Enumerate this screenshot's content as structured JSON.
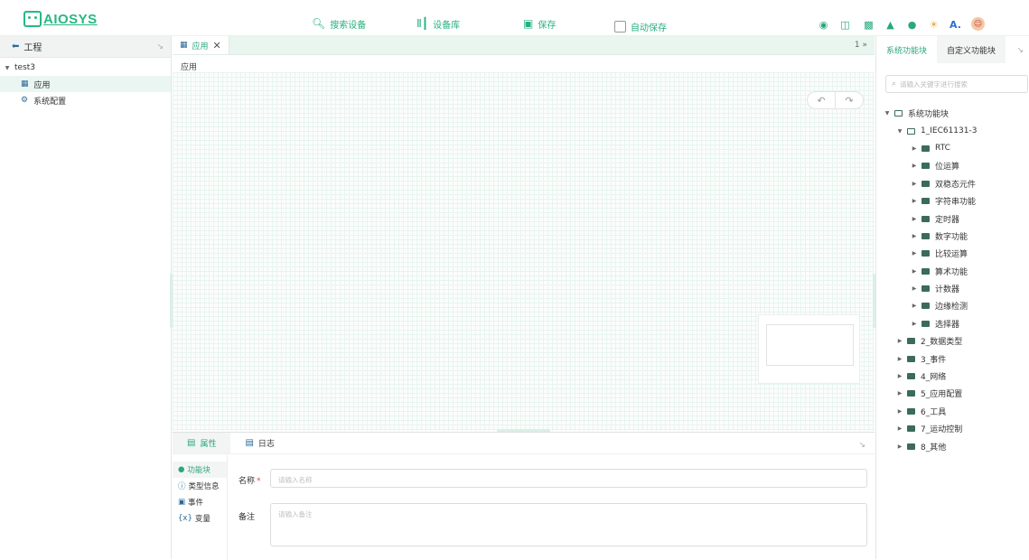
{
  "app": {
    "logo_text": "AIOSYS",
    "accent": "#28b784"
  },
  "toolbar": {
    "search_label": "搜索设备",
    "library_label": "设备库",
    "save_label": "保存",
    "autosave_label": "自动保存",
    "autosave_checked": false
  },
  "user": {
    "initial": "A."
  },
  "left_panel": {
    "title": "工程",
    "project": "test3",
    "items": [
      {
        "label": "应用",
        "icon": "grid-icon",
        "selected": true
      },
      {
        "label": "系统配置",
        "icon": "gear-icon",
        "selected": false
      }
    ]
  },
  "editor": {
    "tab_label": "应用",
    "tab_count": "1",
    "breadcrumb": "应用"
  },
  "bottom_panel": {
    "tabs": [
      {
        "label": "属性",
        "active": true
      },
      {
        "label": "日志",
        "active": false
      }
    ],
    "side_items": [
      {
        "label": "功能块",
        "icon": "block-icon",
        "active": true
      },
      {
        "label": "类型信息",
        "icon": "info-icon",
        "active": false
      },
      {
        "label": "事件",
        "icon": "calendar-icon",
        "active": false
      },
      {
        "label": "变量",
        "icon": "variable-icon",
        "active": false
      }
    ],
    "form": {
      "name_label": "名称",
      "name_placeholder": "请输入名称",
      "name_value": "",
      "note_label": "备注",
      "note_placeholder": "请输入备注",
      "note_value": ""
    }
  },
  "right_panel": {
    "tabs": [
      "系统功能块",
      "自定义功能块"
    ],
    "active_tab": 0,
    "search_placeholder": "请输入关键字进行搜索",
    "tree": [
      {
        "label": "系统功能块",
        "level": 0,
        "expanded": true
      },
      {
        "label": "1_IEC61131-3",
        "level": 1,
        "expanded": true
      },
      {
        "label": "RTC",
        "level": 2
      },
      {
        "label": "位运算",
        "level": 2
      },
      {
        "label": "双稳态元件",
        "level": 2
      },
      {
        "label": "字符串功能",
        "level": 2
      },
      {
        "label": "定时器",
        "level": 2
      },
      {
        "label": "数字功能",
        "level": 2
      },
      {
        "label": "比较运算",
        "level": 2
      },
      {
        "label": "算术功能",
        "level": 2
      },
      {
        "label": "计数器",
        "level": 2
      },
      {
        "label": "边缘检测",
        "level": 2
      },
      {
        "label": "选择器",
        "level": 2
      },
      {
        "label": "2_数据类型",
        "level": 1
      },
      {
        "label": "3_事件",
        "level": 1
      },
      {
        "label": "4_网络",
        "level": 1
      },
      {
        "label": "5_应用配置",
        "level": 1
      },
      {
        "label": "6_工具",
        "level": 1
      },
      {
        "label": "7_运动控制",
        "level": 1
      },
      {
        "label": "8_其他",
        "level": 1
      }
    ]
  }
}
